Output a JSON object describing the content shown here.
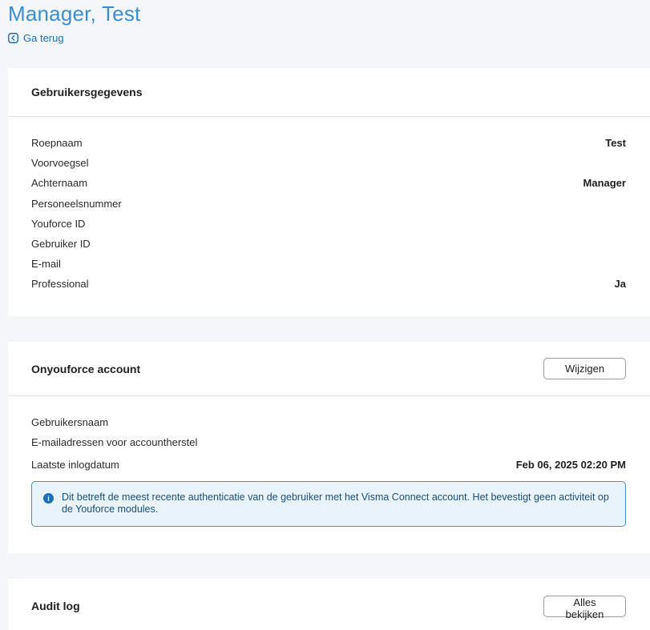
{
  "header": {
    "title": "Manager, Test",
    "back_label": "Ga terug"
  },
  "user_details": {
    "title": "Gebruikersgegevens",
    "rows": [
      {
        "label": "Roepnaam",
        "value": "Test"
      },
      {
        "label": "Voorvoegsel",
        "value": ""
      },
      {
        "label": "Achternaam",
        "value": "Manager"
      },
      {
        "label": "Personeelsnummer",
        "value": ""
      },
      {
        "label": "Youforce ID",
        "value": ""
      },
      {
        "label": "Gebruiker ID",
        "value": ""
      },
      {
        "label": "E-mail",
        "value": ""
      },
      {
        "label": "Professional",
        "value": "Ja"
      }
    ]
  },
  "account": {
    "title": "Onyouforce account",
    "edit_label": "Wijzigen",
    "rows": [
      {
        "label": "Gebruikersnaam",
        "value": ""
      },
      {
        "label": "E-mailadressen voor accountherstel",
        "value": ""
      },
      {
        "label": "Laatste inlogdatum",
        "value": "Feb 06, 2025 02:20 PM"
      }
    ],
    "info_text": "Dit betreft de meest recente authenticatie van de gebruiker met het Visma Connect account. Het bevestigt geen activiteit op de Youforce modules."
  },
  "audit_log": {
    "title": "Audit log",
    "view_all_label": "Alles bekijken"
  },
  "colors": {
    "title": "#3a8fd0",
    "link": "#1b6fb8",
    "info_border": "#4a90c4",
    "info_bg": "#e8f3fb",
    "page_bg": "#f4f6f9"
  }
}
